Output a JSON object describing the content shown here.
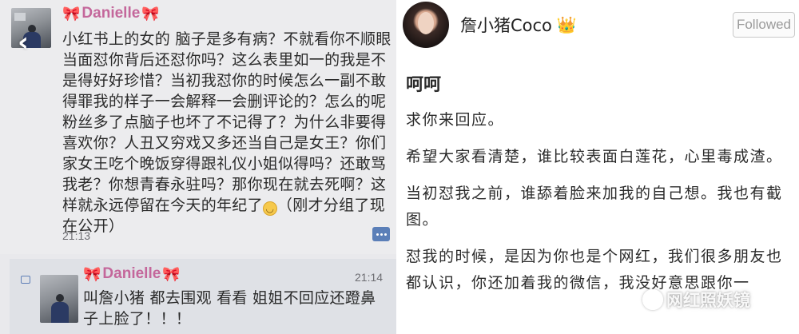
{
  "left_chat": {
    "message1": {
      "sender": "Danielle",
      "bow_left": "🎀",
      "bow_right": "🎀",
      "text": "小红书上的女的 脑子是多有病？不就看你不顺眼当面怼你背后还怼你吗？这么表里如一的我是不是得好好珍惜？当初我怼你的时候怎么一副不敢得罪我的样子一会解释一会删评论的？怎么的呢粉丝多了点脑子也坏了不记得了？为什么非要得喜欢你？人丑又穷戏又多还当自己是女王？你们家女王吃个晚饭穿得跟礼仪小姐似得吗？还敢骂我老？你想青春永驻吗？那你现在就去死啊？这样就永远停留在今天的年纪了",
      "text_after_emoji": "（刚才分组了现在公开）",
      "time": "21:13"
    },
    "message2": {
      "sender": "Danielle",
      "bow_left": "🎀",
      "bow_right": "🎀",
      "text": "叫詹小猪 都去围观 看看 姐姐不回应还蹬鼻子上脸了！！！",
      "time": "21:14"
    }
  },
  "right_post": {
    "username": "詹小猪Coco",
    "crown": "👑",
    "follow_label": "Followed",
    "title": "呵呵",
    "paragraphs": [
      "求你来回应。",
      "希望大家看清楚，谁比较表面白莲花，心里毒成渣。",
      "当初怼我之前，谁舔着脸来加我的自己想。我也有截图。",
      "怼我的时候，是因为你也是个网红，我们很多朋友也都认识，你还加着我的微信，我没好意思跟你一"
    ],
    "watermark": "网红照妖镜"
  },
  "icons": {
    "back": "chevron-left-icon",
    "more": "more-icon",
    "crown": "crown-icon",
    "emoji": "smile-emoji-icon",
    "watermark": "wechat-logo-icon"
  }
}
